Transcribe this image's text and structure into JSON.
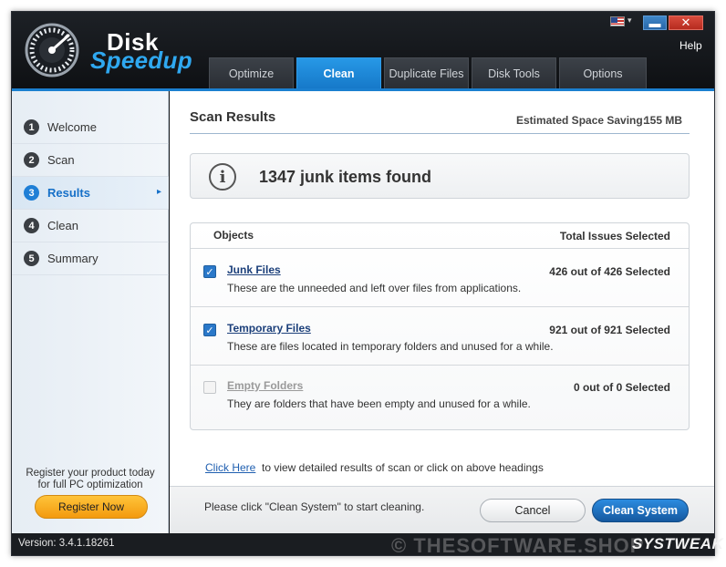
{
  "app": {
    "logo_line1": "Disk",
    "logo_line2": "Speedup",
    "help": "Help",
    "min_glyph": "▬",
    "close_glyph": "✕",
    "flag_caret": "▾"
  },
  "tabs": [
    {
      "label": "Optimize",
      "active": false
    },
    {
      "label": "Clean",
      "active": true
    },
    {
      "label": "Duplicate Files",
      "active": false
    },
    {
      "label": "Disk Tools",
      "active": false
    },
    {
      "label": "Options",
      "active": false
    }
  ],
  "sidebar": {
    "steps": [
      {
        "num": "1",
        "label": "Welcome"
      },
      {
        "num": "2",
        "label": "Scan"
      },
      {
        "num": "3",
        "label": "Results",
        "active": true,
        "arrow": "▸"
      },
      {
        "num": "4",
        "label": "Clean"
      },
      {
        "num": "5",
        "label": "Summary"
      }
    ],
    "register_text_line1": "Register your product today",
    "register_text_line2": "for full PC optimization",
    "register_button": "Register Now"
  },
  "main": {
    "title": "Scan Results",
    "saving_label": "Estimated Space Saving:",
    "saving_value": "155 MB",
    "info_glyph": "i",
    "found_text": "1347 junk items found",
    "objects_header": "Objects",
    "issues_header": "Total Issues Selected",
    "rows": [
      {
        "title": "Junk Files",
        "desc": "These are the unneeded and left over files from applications.",
        "count": "426 out of 426 Selected",
        "checked": true,
        "check_glyph": "✓"
      },
      {
        "title": "Temporary Files",
        "desc": "These are files located in temporary folders and unused for a while.",
        "count": "921 out of 921 Selected",
        "checked": true,
        "check_glyph": "✓"
      },
      {
        "title": "Empty Folders",
        "desc": "They are folders that have been empty and unused for a while.",
        "count": "0 out of 0 Selected",
        "checked": false,
        "check_glyph": ""
      }
    ],
    "click_here": "Click Here",
    "click_rest": "to view detailed results of scan or click on above headings"
  },
  "footer": {
    "message": "Please click \"Clean System\" to start cleaning.",
    "cancel": "Cancel",
    "clean": "Clean System"
  },
  "status": {
    "version": "Version: 3.4.1.18261",
    "watermark": "© THESOFTWARE.SHOP",
    "brand": "SYSTWEAK"
  },
  "colors": {
    "accent": "#1f7fd6",
    "header_bg": "#111418",
    "register": "#f7a81c"
  }
}
